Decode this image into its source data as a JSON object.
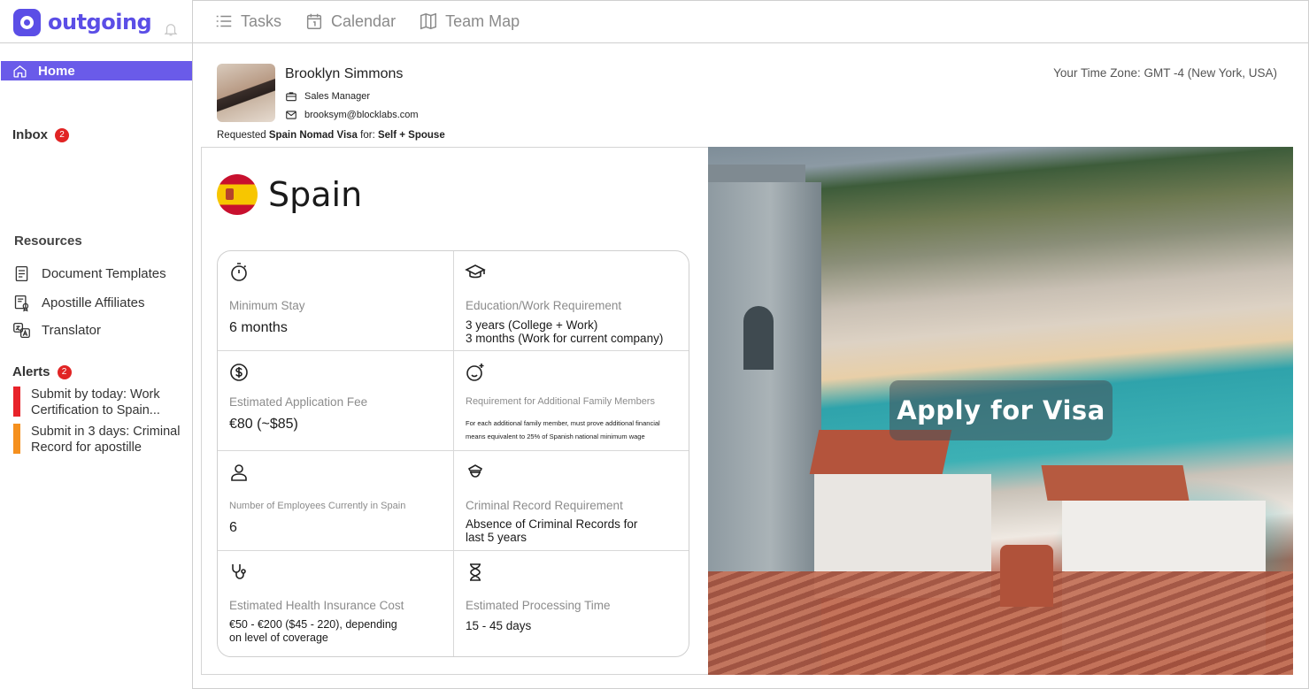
{
  "brand": {
    "name": "outgoing",
    "accent": "#5b4ee6"
  },
  "sidebar": {
    "home_label": "Home",
    "inbox_label": "Inbox",
    "inbox_count": "2",
    "resources_title": "Resources",
    "resources": [
      {
        "label": "Document Templates",
        "icon": "document-icon"
      },
      {
        "label": "Apostille Affiliates",
        "icon": "certificate-icon"
      },
      {
        "label": "Translator",
        "icon": "translate-icon"
      }
    ],
    "alerts_title": "Alerts",
    "alerts_count": "2",
    "alerts": [
      {
        "text": "Submit by today: Work Certification to Spain...",
        "color": "#e8232a"
      },
      {
        "text": "Submit in 3 days: Criminal Record for apostille",
        "color": "#f5901e"
      }
    ]
  },
  "topnav": {
    "tabs": [
      {
        "label": "Tasks",
        "icon": "list-icon"
      },
      {
        "label": "Calendar",
        "icon": "calendar-icon"
      },
      {
        "label": "Team Map",
        "icon": "map-icon"
      }
    ]
  },
  "profile": {
    "name": "Brooklyn Simmons",
    "title": "Sales Manager",
    "email": "brooksym@blocklabs.com",
    "request_prefix": "Requested ",
    "request_visa": "Spain Nomad Visa",
    "request_mid": " for: ",
    "request_for": "Self + Spouse",
    "timezone": "Your Time Zone: GMT -4 (New York, USA)"
  },
  "country": {
    "name": "Spain",
    "details": [
      {
        "label": "Minimum Stay",
        "value": "6 months",
        "icon": "stopwatch-icon"
      },
      {
        "label": "Education/Work Requirement",
        "value_lines": [
          "3 years (College + Work)",
          "3 months (Work for current company)"
        ],
        "icon": "graduation-cap-icon"
      },
      {
        "label": "Estimated Application Fee",
        "value": "€80 (~$85)",
        "icon": "dollar-coin-icon"
      },
      {
        "label": "Requirement for Additional Family Members",
        "value_lines": [
          "For each additional family member, must prove additional financial",
          "means equivalent to 25% of Spanish national minimum wage"
        ],
        "icon": "smiley-plus-icon"
      },
      {
        "label": "Number of Employees Currently in Spain",
        "value": "6",
        "icon": "person-icon"
      },
      {
        "label": "Criminal Record Requirement",
        "value_lines": [
          "Absence of Criminal Records for",
          "last 5 years"
        ],
        "icon": "police-icon"
      },
      {
        "label": "Estimated Health Insurance Cost",
        "value_lines": [
          "€50 - €200 ($45 - 220), depending",
          "on level of coverage"
        ],
        "icon": "stethoscope-icon"
      },
      {
        "label": "Estimated Processing Time",
        "value": "15 - 45 days",
        "icon": "hourglass-icon"
      }
    ]
  },
  "cta": {
    "apply_label": "Apply for Visa"
  }
}
